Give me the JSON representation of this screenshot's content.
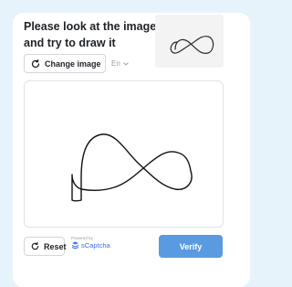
{
  "prompt": {
    "title": "Please look at the image and try to draw it"
  },
  "sample_image": {
    "icon": "infinity-sketch"
  },
  "controls": {
    "change_image_label": "Change image",
    "language_label": "En",
    "reset_label": "Reset",
    "verify_label": "Verify"
  },
  "branding": {
    "powered_by": "Powered by",
    "brand_name": "sCaptcha"
  },
  "colors": {
    "page_background": "#e7f3fb",
    "card_background": "#ffffff",
    "verify_button": "#5a9ae0",
    "brand": "#3d6fe8"
  }
}
